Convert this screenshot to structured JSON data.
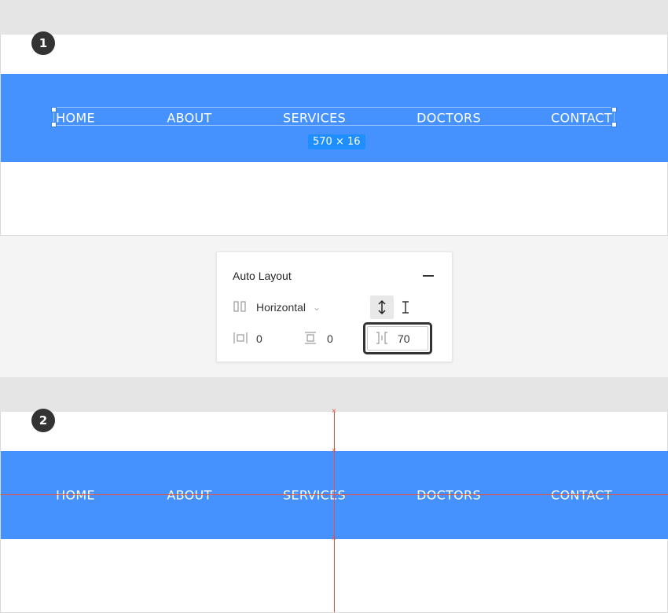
{
  "step1": {
    "badge": "1",
    "dimension_tag": "570 × 16"
  },
  "step2": {
    "badge": "2"
  },
  "nav": {
    "items": [
      "HOME",
      "ABOUT",
      "SERVICES",
      "DOCTORS",
      "CONTACT"
    ],
    "color": "#4592ff"
  },
  "panel": {
    "title": "Auto Layout",
    "direction": "Horizontal",
    "horizontal_padding": "0",
    "vertical_padding": "0",
    "item_spacing": "70",
    "icons": {
      "minus": "minus-icon",
      "direction": "horizontal-layout-icon",
      "chevron": "chevron-down-icon",
      "vertical_resize": "resize-vertical-icon",
      "text_cursor": "text-cursor-icon",
      "h_padding": "horizontal-padding-icon",
      "v_padding": "vertical-padding-icon",
      "spacing": "spacing-between-icon"
    }
  },
  "colors": {
    "guide": "#ef4e3a",
    "selection": "#2f80ed",
    "dim_tag": "#1f8fff"
  }
}
